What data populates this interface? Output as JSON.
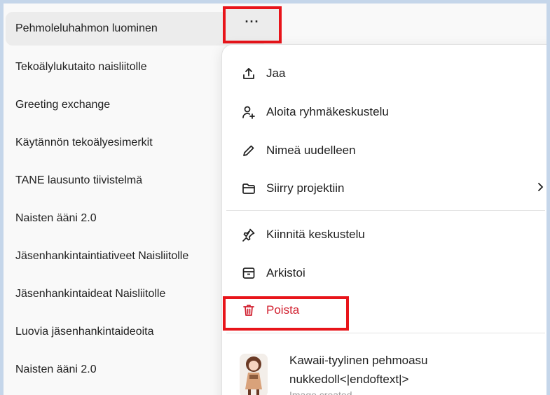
{
  "sidebar": {
    "items": [
      {
        "label": "Pehmoleluhahmon luominen"
      },
      {
        "label": "Tekoälylukutaito naisliitolle"
      },
      {
        "label": "Greeting exchange"
      },
      {
        "label": "Käytännön tekoälyesimerkit"
      },
      {
        "label": "TANE lausunto tiivistelmä"
      },
      {
        "label": "Naisten ääni 2.0"
      },
      {
        "label": "Jäsenhankintaintiativeet Naisliitolle"
      },
      {
        "label": "Jäsenhankintaideat Naisliitolle"
      },
      {
        "label": "Luovia jäsenhankintaideoita"
      },
      {
        "label": "Naisten ääni 2.0"
      }
    ],
    "more_label": "···"
  },
  "menu": {
    "share": {
      "label": "Jaa",
      "icon": "share-icon"
    },
    "group_chat": {
      "label": "Aloita ryhmäkeskustelu",
      "icon": "add-person-icon"
    },
    "rename": {
      "label": "Nimeä uudelleen",
      "icon": "pencil-icon"
    },
    "move_project": {
      "label": "Siirry projektiin",
      "icon": "folder-icon"
    },
    "pin": {
      "label": "Kiinnitä keskustelu",
      "icon": "pin-icon"
    },
    "archive": {
      "label": "Arkistoi",
      "icon": "archive-icon"
    },
    "delete": {
      "label": "Poista",
      "icon": "trash-icon"
    }
  },
  "image_preview": {
    "title": "Kawaii-tyylinen pehmoasu nukkedoll<|endoftext|>",
    "subtitle": "Image created"
  },
  "colors": {
    "danger": "#d11f2e",
    "highlight": "#e8141a",
    "background": "#c5d6ea"
  }
}
